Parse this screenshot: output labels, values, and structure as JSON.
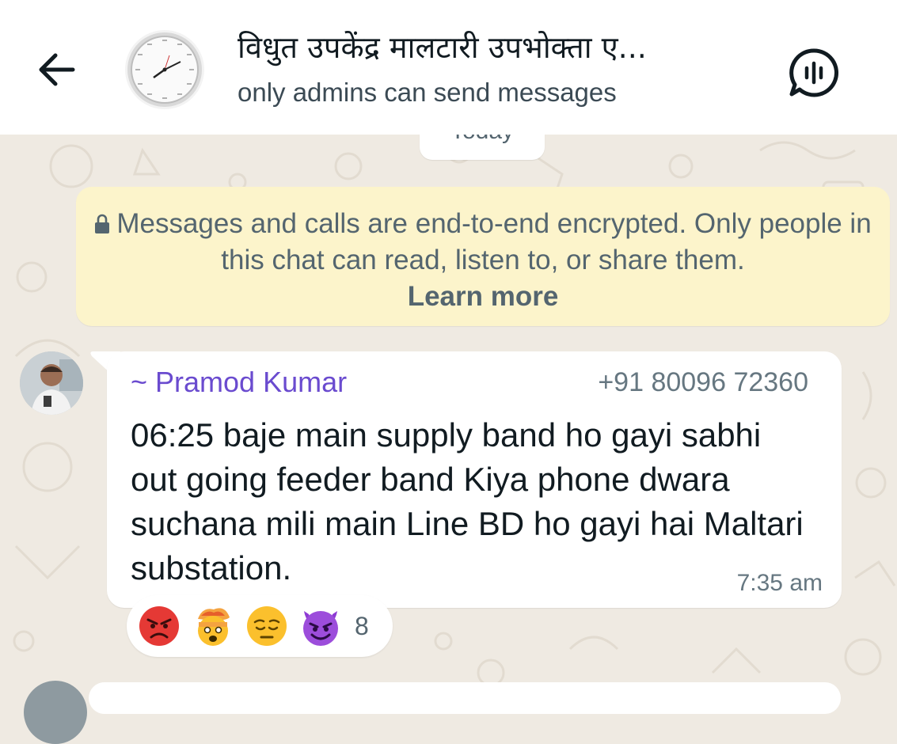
{
  "header": {
    "title": "विधुत उपकेंद्र मालटारी उपभोक्ता ए...",
    "subtitle": "only admins can send messages"
  },
  "date_chip": {
    "label": "Today"
  },
  "encryption_notice": {
    "text": "Messages and calls are end-to-end encrypted. Only people in this chat can read, listen to, or share them.",
    "link_label": "Learn more"
  },
  "message": {
    "sender_name": "~ Pramod Kumar",
    "sender_phone": "+91 80096 72360",
    "text": "06:25 baje main supply band ho gayi sabhi out going feeder band Kiya phone dwara suchana mili main Line BD ho gayi hai Maltari substation.",
    "time": "7:35 am",
    "reactions": {
      "emojis": [
        "angry-face",
        "exploding-head",
        "pensive-face",
        "smiling-devil"
      ],
      "count": "8"
    }
  },
  "colors": {
    "wallpaper": "#efeae2",
    "notice_bg": "#fcf4cb",
    "sender_name": "#6a4bcf",
    "meta_text": "#667781"
  }
}
